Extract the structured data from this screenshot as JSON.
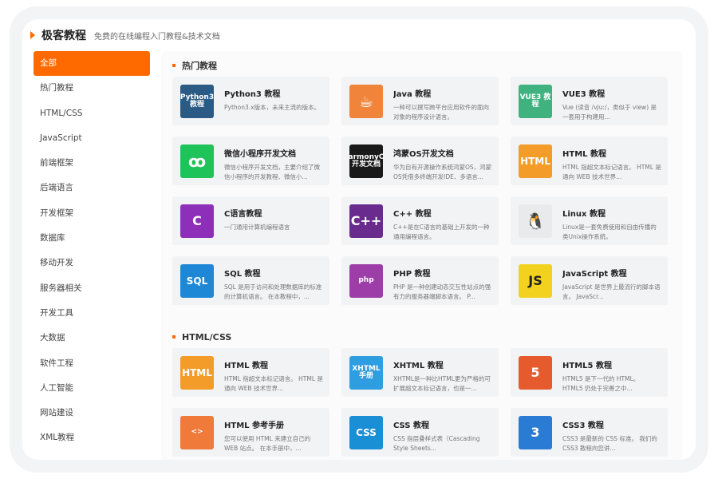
{
  "header": {
    "title": "极客教程",
    "subtitle": "免费的在线编程入门教程&技术文档"
  },
  "sidebar": {
    "items": [
      {
        "label": "全部"
      },
      {
        "label": "热门教程"
      },
      {
        "label": "HTML/CSS"
      },
      {
        "label": "JavaScript"
      },
      {
        "label": "前端框架"
      },
      {
        "label": "后端语言"
      },
      {
        "label": "开发框架"
      },
      {
        "label": "数据库"
      },
      {
        "label": "移动开发"
      },
      {
        "label": "服务器相关"
      },
      {
        "label": "开发工具"
      },
      {
        "label": "大数据"
      },
      {
        "label": "软件工程"
      },
      {
        "label": "人工智能"
      },
      {
        "label": "网站建设"
      },
      {
        "label": "XML教程"
      }
    ]
  },
  "sections": [
    {
      "title": "热门教程",
      "cards": [
        {
          "title": "Python3 教程",
          "desc": "Python3.x版本，未来主流的版本。",
          "icon": "Python3\n教程",
          "icon_name": "python-icon",
          "color": "#2b5b84"
        },
        {
          "title": "Java 教程",
          "desc": "一种可以撰写跨平台应用软件的面向对象的程序设计语言。",
          "icon": "☕",
          "icon_name": "java-icon",
          "color": "#f0843a"
        },
        {
          "title": "VUE3 教程",
          "desc": "Vue (读音 /vjuː/，类似于 view) 是一套用于构建用...",
          "icon": "VUE3 教程",
          "icon_name": "vue-icon",
          "color": "#3fb27f"
        },
        {
          "title": "微信小程序开发文档",
          "desc": "微信小程序开发文档，主要介绍了微信小程序的开发教程、微信小...",
          "icon": "ꝏ",
          "icon_name": "wechat-miniprogram-icon",
          "color": "#1ec35a"
        },
        {
          "title": "鸿蒙OS开发文档",
          "desc": "华为自有开源操作系统鸿蒙OS，鸿蒙OS凭借多终端开发IDE、多语言...",
          "icon": "HarmonyOS\n开发文档",
          "icon_name": "harmonyos-icon",
          "color": "#1a1a1a"
        },
        {
          "title": "HTML 教程",
          "desc": "HTML 指超文本标记语言。 HTML 是通向 WEB 技术世界...",
          "icon": "HTML",
          "icon_name": "html-icon",
          "color": "#f39c2a"
        },
        {
          "title": "C语言教程",
          "desc": "一门通用计算机编程语言",
          "icon": "C",
          "icon_name": "c-language-icon",
          "color": "#8d2fb8"
        },
        {
          "title": "C++ 教程",
          "desc": "C++是在C语言的基础上开发的一种通用编程语言。",
          "icon": "C++",
          "icon_name": "cpp-icon",
          "color": "#6a2b8e"
        },
        {
          "title": "Linux 教程",
          "desc": "Linux是一套免费使用和自由传播的类Unix操作系统。",
          "icon": "🐧",
          "icon_name": "linux-icon",
          "color": "#e9eaec"
        },
        {
          "title": "SQL 教程",
          "desc": "SQL 是用于访问和处理数据库的标准的计算机语言。 在本教程中，...",
          "icon": "SQL",
          "icon_name": "sql-icon",
          "color": "#1e88d6"
        },
        {
          "title": "PHP 教程",
          "desc": "PHP 是一种创建动态交互性站点的强有力的服务器端脚本语言。 P...",
          "icon": "php",
          "icon_name": "php-icon",
          "color": "#9d3ea8"
        },
        {
          "title": "JavaScript 教程",
          "desc": "JavaScript 是世界上最流行的脚本语言。 JavaScr...",
          "icon": "JS",
          "icon_name": "javascript-icon",
          "color": "#f3d21f"
        }
      ]
    },
    {
      "title": "HTML/CSS",
      "cards": [
        {
          "title": "HTML 教程",
          "desc": "HTML 指超文本标记语言。 HTML 是通向 WEB 技术世界...",
          "icon": "HTML",
          "icon_name": "html-icon",
          "color": "#f39c2a"
        },
        {
          "title": "XHTML 教程",
          "desc": "XHTML是一种比HTML更为严格的可扩展超文本标记语言，也是一...",
          "icon": "XHTML手册",
          "icon_name": "xhtml-icon",
          "color": "#2e9ee0"
        },
        {
          "title": "HTML5 教程",
          "desc": "HTML5 是下一代的 HTML。 HTML5 仍处于完善之中...",
          "icon": "5",
          "icon_name": "html5-icon",
          "color": "#e65b2d"
        },
        {
          "title": "HTML 参考手册",
          "desc": "您可以使用 HTML 来建立自己的 WEB 站点。 在本手册中，...",
          "icon": "<>",
          "icon_name": "html-reference-icon",
          "color": "#ef7a3a"
        },
        {
          "title": "CSS 教程",
          "desc": "CSS 指层叠样式表（Cascading Style Sheets...",
          "icon": "CSS",
          "icon_name": "css-icon",
          "color": "#1b8fd6"
        },
        {
          "title": "CSS3 教程",
          "desc": "CSS3 是最新的 CSS 标准。 我们的 CSS3 教程向您讲...",
          "icon": "3",
          "icon_name": "css3-icon",
          "color": "#2a7bd3"
        }
      ]
    }
  ]
}
